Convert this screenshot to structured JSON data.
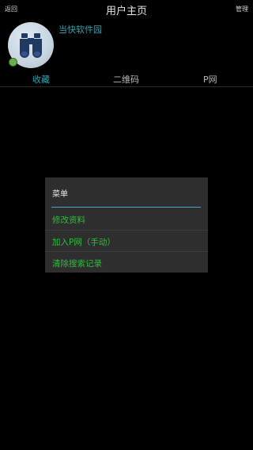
{
  "topbar": {
    "back_label": "返回",
    "title": "用户主页",
    "manage_label": "管理"
  },
  "profile": {
    "username": "当快软件园",
    "online_color": "#6ab04c",
    "avatar_icon": "binoculars-icon"
  },
  "tabs": [
    {
      "label": "收藏",
      "active": true
    },
    {
      "label": "二维码",
      "active": false
    },
    {
      "label": "P网",
      "active": false
    }
  ],
  "menu": {
    "title": "菜单",
    "items": [
      {
        "label": "修改资料"
      },
      {
        "label": "加入P网（手动）"
      },
      {
        "label": "清除搜索记录"
      }
    ]
  },
  "colors": {
    "accent": "#27a7b3",
    "menu_item": "#2fbd3d",
    "background": "#000000"
  }
}
